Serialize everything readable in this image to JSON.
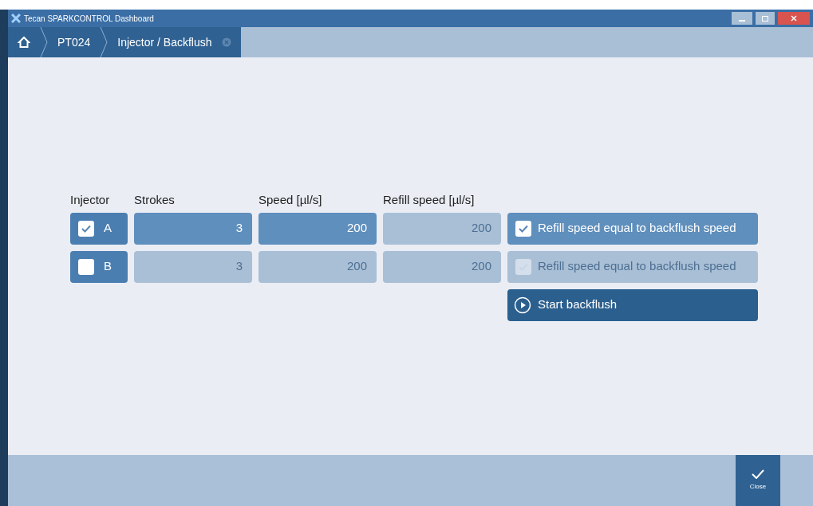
{
  "window": {
    "title": "Tecan SPARKCONTROL Dashboard"
  },
  "breadcrumb": [
    {
      "label": "PT024"
    },
    {
      "label": "Injector / Backflush"
    }
  ],
  "columns": [
    "Injector",
    "Strokes",
    "Speed [µl/s]",
    "Refill speed [µl/s]"
  ],
  "rows": [
    {
      "injector": "A",
      "checked": true,
      "strokes": {
        "value": "3",
        "disabled": false
      },
      "speed": {
        "value": "200",
        "disabled": false
      },
      "refill_speed": {
        "value": "200",
        "disabled": true
      },
      "refill_equal": {
        "label": "Refill speed equal to backflush speed",
        "checked": true,
        "disabled": false
      }
    },
    {
      "injector": "B",
      "checked": false,
      "strokes": {
        "value": "3",
        "disabled": true
      },
      "speed": {
        "value": "200",
        "disabled": true
      },
      "refill_speed": {
        "value": "200",
        "disabled": true
      },
      "refill_equal": {
        "label": "Refill speed equal to backflush speed",
        "checked": true,
        "disabled": true
      }
    }
  ],
  "start_button": {
    "label": "Start backflush"
  },
  "footer": {
    "close_label": "Close"
  }
}
